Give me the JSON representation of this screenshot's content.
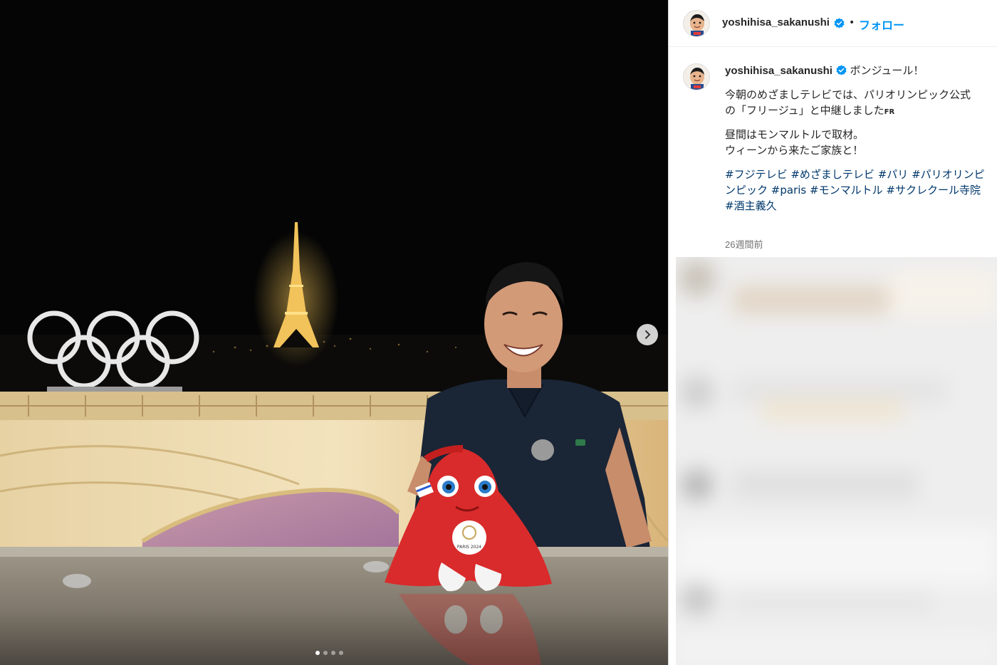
{
  "photo": {
    "slide_count": 4,
    "active_slide": 1,
    "mascot_badge_text": "PARIS 2024"
  },
  "header": {
    "username": "yoshihisa_sakanushi",
    "separator": "•",
    "follow_label": "フォロー"
  },
  "caption": {
    "username": "yoshihisa_sakanushi",
    "greeting": "ボンジュール！",
    "line1": "今朝のめざましテレビでは、パリオリンピック公式",
    "line2": "の「フリージュ」と中継しました",
    "flag_text": "FR",
    "line3": "昼間はモンマルトルで取材。",
    "line4": "ウィーンから来たご家族と！",
    "hashtags_line1": [
      "#フジテレビ",
      "#めざましテレビ",
      "#パリ",
      "#パリオリンピ"
    ],
    "hashtags_line2": [
      "ンピック",
      "#paris",
      "#モンマルトル",
      "#サクレクール寺院"
    ],
    "hashtags_line3": [
      "#酒主義久"
    ],
    "timestamp": "26週間前"
  },
  "colors": {
    "follow": "#0095f6",
    "hashtag": "#00376b",
    "verified": "#0095f6"
  }
}
